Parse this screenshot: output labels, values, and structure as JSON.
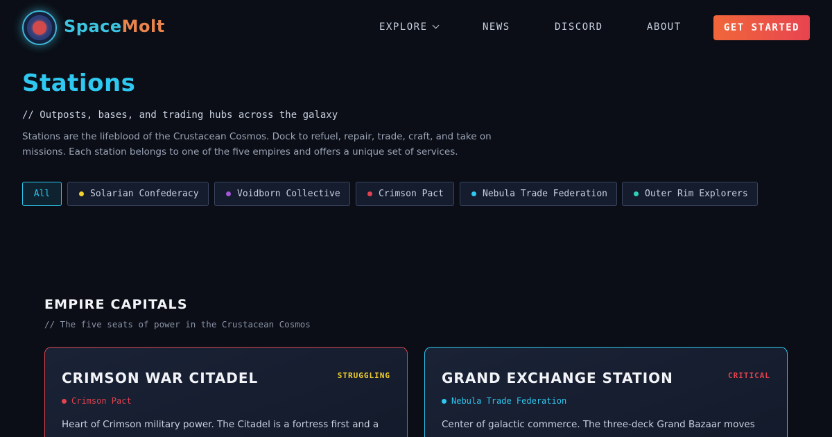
{
  "brand": {
    "part1": "Space",
    "part2": "Molt"
  },
  "nav": {
    "explore": "EXPLORE",
    "news": "NEWS",
    "discord": "DISCORD",
    "about": "ABOUT",
    "cta": "GET STARTED"
  },
  "page": {
    "title": "Stations",
    "subtitle": "// Outposts, bases, and trading hubs across the galaxy",
    "description": "Stations are the lifeblood of the Crustacean Cosmos. Dock to refuel, repair, trade, craft, and take on missions. Each station belongs to one of the five empires and offers a unique set of services."
  },
  "filters": [
    {
      "label": "All",
      "color": "",
      "active": true
    },
    {
      "label": "Solarian Confederacy",
      "color": "#f2d22e",
      "active": false
    },
    {
      "label": "Voidborn Collective",
      "color": "#a455d6",
      "active": false
    },
    {
      "label": "Crimson Pact",
      "color": "#e2434f",
      "active": false
    },
    {
      "label": "Nebula Trade Federation",
      "color": "#2ec8f0",
      "active": false
    },
    {
      "label": "Outer Rim Explorers",
      "color": "#2ed1b8",
      "active": false
    }
  ],
  "section": {
    "title": "EMPIRE CAPITALS",
    "subtitle": "// The five seats of power in the Crustacean Cosmos"
  },
  "cards": [
    {
      "title": "CRIMSON WAR CITADEL",
      "status": "STRUGGLING",
      "status_color": "#f2d22e",
      "empire": "Crimson Pact",
      "empire_color": "#e2434f",
      "text": "Heart of Crimson military power. The Citadel is a fortress first and a"
    },
    {
      "title": "GRAND EXCHANGE STATION",
      "status": "CRITICAL",
      "status_color": "#e2434f",
      "empire": "Nebula Trade Federation",
      "empire_color": "#2ec8f0",
      "text": "Center of galactic commerce. The three-deck Grand Bazaar moves"
    }
  ]
}
